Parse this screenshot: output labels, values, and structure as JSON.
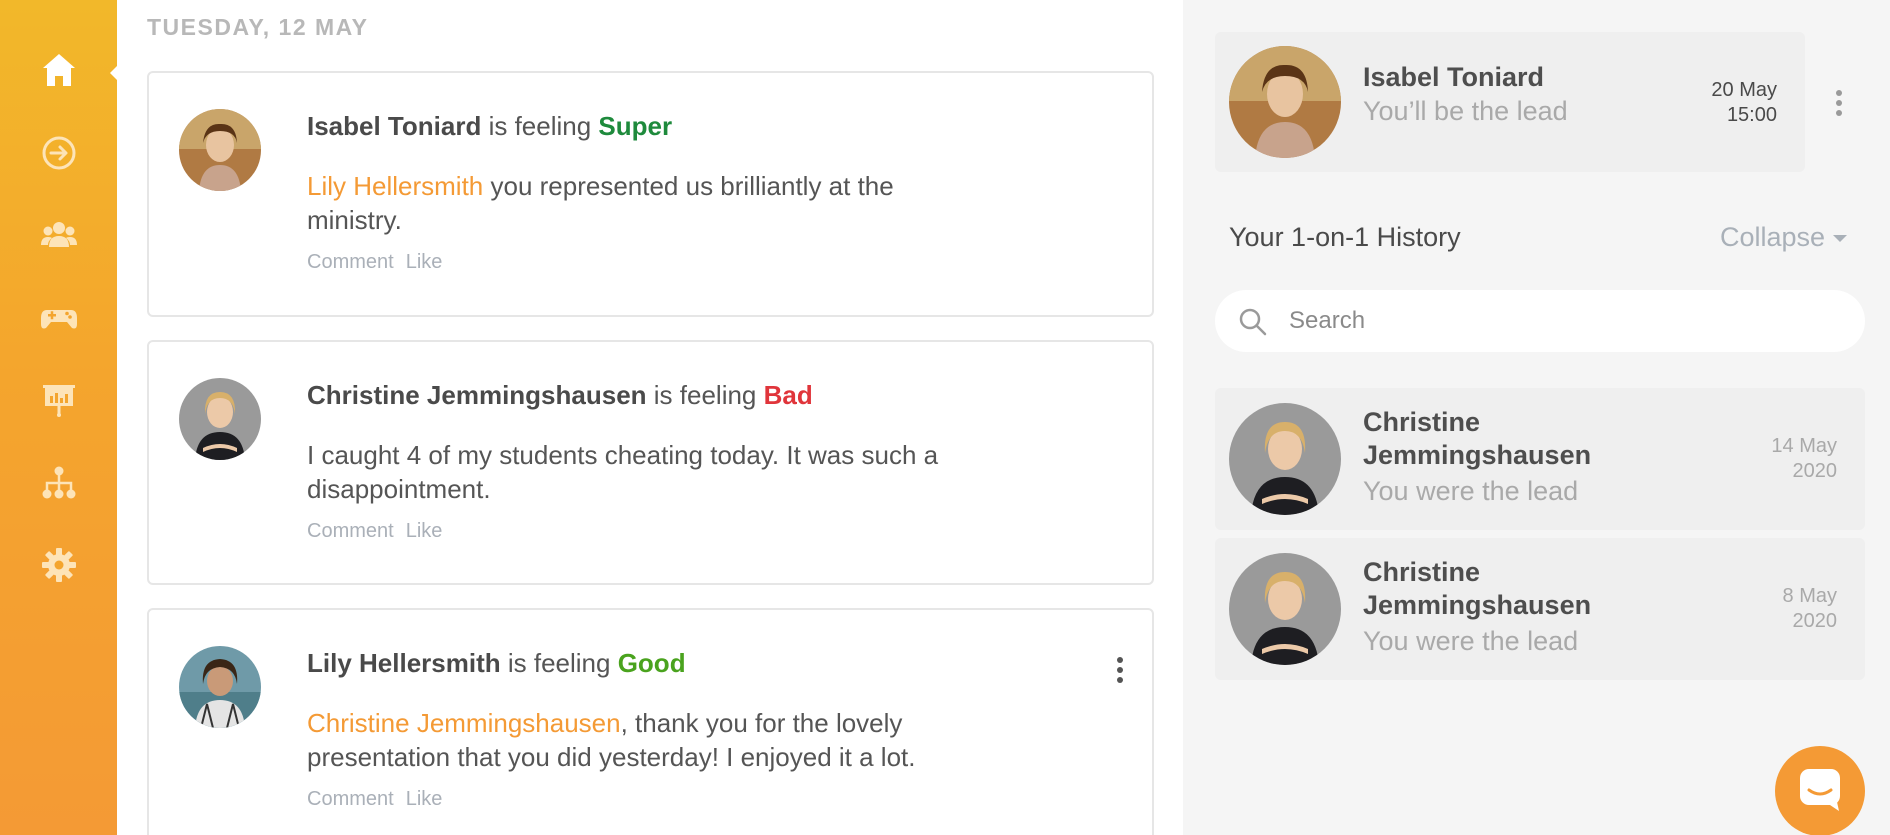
{
  "colors": {
    "sidebar_gradient_top": "#f2b82a",
    "sidebar_gradient_bottom": "#f49a35",
    "accent": "#f49a35",
    "mood_super": "#1e8a3c",
    "mood_bad": "#e0353b",
    "mood_good": "#4aa31e"
  },
  "sidebar": {
    "items": [
      {
        "icon": "home-icon",
        "active": true
      },
      {
        "icon": "arrow-right-circle-icon"
      },
      {
        "icon": "users-icon"
      },
      {
        "icon": "gamepad-icon"
      },
      {
        "icon": "presentation-chart-icon"
      },
      {
        "icon": "org-chart-icon"
      },
      {
        "icon": "gear-icon"
      }
    ]
  },
  "feed": {
    "date_heading": "TUESDAY, 12 MAY",
    "posts": [
      {
        "author": "Isabel Toniard",
        "feeling_text": " is feeling ",
        "mood": "Super",
        "mention": "Lily Hellersmith",
        "text": " you represented us brilliantly at the ministry.",
        "comment_label": "Comment",
        "like_label": "Like"
      },
      {
        "author": "Christine Jemmingshausen",
        "feeling_text": " is feeling ",
        "mood": "Bad",
        "mention": "",
        "text": "I caught 4 of my students cheating today. It was such a disappointment.",
        "comment_label": "Comment",
        "like_label": "Like"
      },
      {
        "author": "Lily Hellersmith",
        "feeling_text": " is feeling ",
        "mood": "Good",
        "mention": "Christine Jemmingshausen",
        "text": ", thank you for the lovely presentation that you did yesterday! I enjoyed it a lot.",
        "comment_label": "Comment",
        "like_label": "Like"
      }
    ]
  },
  "right_panel": {
    "upcoming": {
      "name": "Isabel Toniard",
      "subtitle": "You’ll be the lead",
      "date": "20 May",
      "time": "15:00"
    },
    "history_title": "Your 1-on-1 History",
    "collapse_label": "Collapse",
    "search": {
      "placeholder": "Search",
      "value": ""
    },
    "history": [
      {
        "name": "Christine Jemmingshausen",
        "subtitle": "You were the lead",
        "date": "14 May",
        "year": "2020"
      },
      {
        "name": "Christine Jemmingshausen",
        "subtitle": "You were the lead",
        "date": "8 May",
        "year": "2020"
      }
    ]
  },
  "chat_button": {
    "icon": "chat-icon"
  }
}
